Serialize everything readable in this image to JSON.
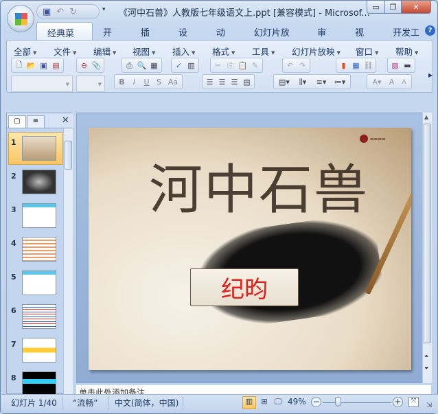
{
  "window": {
    "title": "《河中石兽》人教版七年级语文上.ppt [兼容模式] - Microsof...",
    "controls": [
      "minimize",
      "restore",
      "close"
    ]
  },
  "qat": {
    "icons": [
      "save-icon",
      "undo-icon",
      "redo-icon",
      "customize-icon"
    ]
  },
  "tabs": [
    {
      "label": "经典菜单",
      "active": true
    },
    {
      "label": "开始"
    },
    {
      "label": "插入"
    },
    {
      "label": "设计"
    },
    {
      "label": "动画"
    },
    {
      "label": "幻灯片放映"
    },
    {
      "label": "审阅"
    },
    {
      "label": "视图"
    },
    {
      "label": "开发工具"
    }
  ],
  "help": "?",
  "menus": [
    "全部",
    "文件",
    "编辑",
    "视图",
    "插入",
    "格式",
    "工具",
    "幻灯片放映",
    "窗口",
    "帮助"
  ],
  "format_buttons": [
    "B",
    "I",
    "U",
    "S",
    "Aa"
  ],
  "slides_panel": {
    "numbers": [
      "1",
      "2",
      "3",
      "4",
      "5",
      "6",
      "7",
      "8"
    ],
    "selected": 1
  },
  "slide": {
    "title": "河中石兽",
    "author": "纪昀"
  },
  "notes": {
    "placeholder": "单击此处添加备注"
  },
  "status": {
    "slide": "幻灯片 1/40",
    "theme": "“流畅”",
    "language": "中文(简体，中国)",
    "zoom": "49%",
    "zoom_value": 49
  },
  "colors": {
    "accent": "#f8c565",
    "author_text": "#e0201a"
  }
}
